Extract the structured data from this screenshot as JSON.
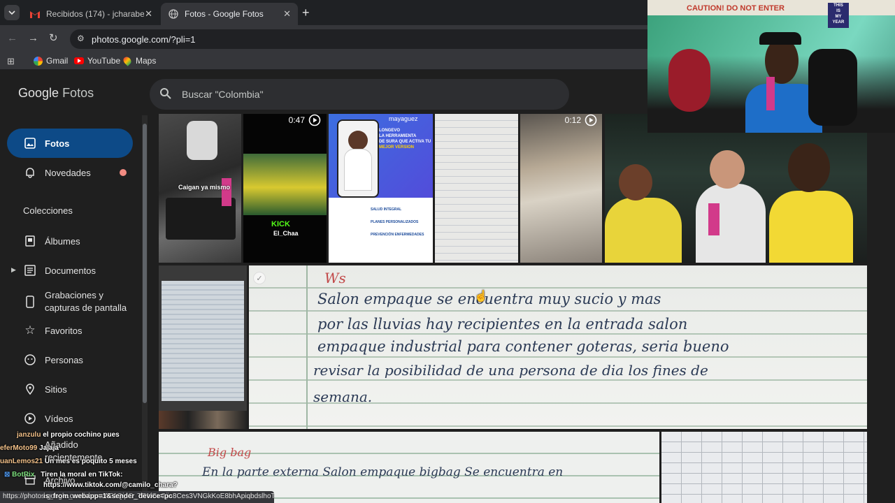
{
  "tabs": [
    {
      "title": "Recibidos (174) - jcharabejarano",
      "icon": "gmail-icon"
    },
    {
      "title": "Fotos - Google Fotos",
      "icon": "globe-icon"
    }
  ],
  "address": "photos.google.com/?pli=1",
  "bookmarks": [
    "Gmail",
    "YouTube",
    "Maps"
  ],
  "app": {
    "logo_google": "Google",
    "logo_fotos": "Fotos",
    "search_placeholder": "Buscar \"Colombia\""
  },
  "sidebar": {
    "items": [
      {
        "label": "Fotos",
        "icon": "photo-icon"
      },
      {
        "label": "Novedades",
        "icon": "bell-icon"
      }
    ],
    "collections_heading": "Colecciones",
    "collections": [
      {
        "label": "Álbumes",
        "icon": "album-icon"
      },
      {
        "label": "Documentos",
        "icon": "document-icon"
      },
      {
        "label": "Grabaciones y capturas de pantalla",
        "line1": "Grabaciones y",
        "line2": "capturas de pantalla",
        "icon": "phone-icon"
      },
      {
        "label": "Favoritos",
        "icon": "star-icon"
      },
      {
        "label": "Personas",
        "icon": "face-icon"
      },
      {
        "label": "Sitios",
        "icon": "pin-icon"
      },
      {
        "label": "Vídeos",
        "icon": "play-icon"
      },
      {
        "label": "Añadido recientemente",
        "line1": "Añadido",
        "line2": "recientemente",
        "icon": "clock-icon"
      },
      {
        "label": "Archivo",
        "icon": "archive-icon"
      }
    ]
  },
  "photos": {
    "video_durations": [
      "0:47",
      "0:12"
    ],
    "overlay_caption": "Caigan ya mismo",
    "kick_label": "KICK",
    "kick_user": "El_Chaa",
    "flyer": {
      "brand": "mayaguez",
      "title_lines": [
        "LONGEVO",
        "LA HERRAMIENTA",
        "DE SURA QUE ACTIVA TU",
        "MEJOR VERSION"
      ],
      "items": [
        "SALUD INTEGRAL",
        "PLANES PERSONALIZADOS",
        "PREVENCIÓN ENFERMEDADES"
      ]
    },
    "note1_lines": [
      "Salon empaque se encuentra muy sucio y mas",
      "por las lluvias hay recipientes en la entrada salon",
      "empaque industrial para contener goteras, seria bueno",
      "revisar la posibilidad de una persona de dia los fines de",
      "semana."
    ],
    "note1_header": "Ws",
    "note2_header": "Big bag",
    "note2_line": "En la parte externa Salon empaque bigbag Se encuentra en"
  },
  "stream": {
    "banner": "CAUTION! DO NOT ENTER",
    "sign": [
      "THIS",
      "IS",
      "MY",
      "YEAR"
    ]
  },
  "chat": [
    {
      "user": "janzulu",
      "msg": "el propio cochino pues"
    },
    {
      "user": "eferMoto99",
      "msg": "Jajaja"
    },
    {
      "user": "uanLemos21",
      "msg": "Un mes es poquito 5 meses"
    },
    {
      "user": "BotRix",
      "msg": "Tiren la moral en TikTok:"
    },
    {
      "user": "",
      "msg": "https://www.tiktok.com/@camilo_chara?"
    },
    {
      "user": "",
      "msg": "is_from_webapp=1&sender_device=pc"
    }
  ],
  "status_url": "https://photos.google.com/share/AF1QipO_TRNGxGjis8Ces3VNGkKoE8bhApiqbdslhoT",
  "colors": {
    "accent": "#0d4a87",
    "chrome": "#35363a",
    "bg": "#1f1f1f",
    "dot": "#f28b82"
  }
}
